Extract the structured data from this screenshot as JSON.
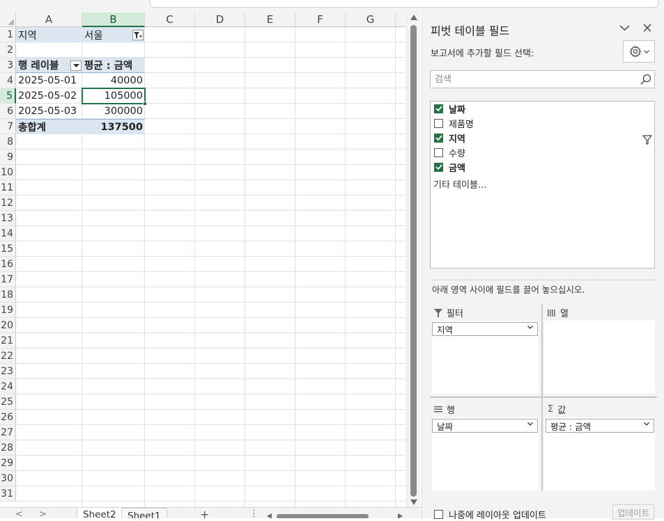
{
  "grid": {
    "columns": [
      "A",
      "B",
      "C",
      "D",
      "E",
      "F",
      "G"
    ],
    "rows": [
      "1",
      "2",
      "3",
      "4",
      "5",
      "6",
      "7",
      "8",
      "9",
      "10",
      "11",
      "12",
      "13",
      "14",
      "15",
      "16",
      "17",
      "18",
      "19",
      "20",
      "21",
      "22",
      "23",
      "24",
      "25",
      "26",
      "27",
      "28",
      "29",
      "30",
      "31"
    ],
    "selected_cell": "B5",
    "cells": {
      "a1": "지역",
      "b1": "서울",
      "a3": "행 레이블",
      "b3": "평균 : 금액",
      "a4": "2025-05-01",
      "b4": "40000",
      "a5": "2025-05-02",
      "b5": "105000",
      "a6": "2025-05-03",
      "b6": "300000",
      "a7": "총합계",
      "b7": "137500"
    }
  },
  "sheet_tabs": {
    "nav_prev": "<",
    "nav_next": ">",
    "tabs": [
      "Sheet2",
      "Sheet1"
    ],
    "active": "Sheet2",
    "add": "+",
    "more": "⋮"
  },
  "pivot_pane": {
    "title": "피벗 테이블 필드",
    "subtitle": "보고서에 추가할 필드 선택:",
    "search_placeholder": "검색",
    "fields": [
      {
        "label": "날짜",
        "checked": true
      },
      {
        "label": "제품명",
        "checked": false
      },
      {
        "label": "지역",
        "checked": true
      },
      {
        "label": "수량",
        "checked": false
      },
      {
        "label": "금액",
        "checked": true
      }
    ],
    "more_tables": "기타 테이블...",
    "drag_hint": "아래 영역 사이에 필드를 끌어 놓으십시오.",
    "areas": {
      "filter_label": "필터",
      "filter_item": "지역",
      "columns_label": "열",
      "rows_label": "행",
      "rows_item": "날짜",
      "values_label": "값",
      "values_item": "평균 : 금액"
    },
    "defer_label": "나중에 레이아웃 업데이트",
    "update_button": "업데이트"
  },
  "colors": {
    "accent": "#217346",
    "pivot_header_fill": "#dce6f1"
  }
}
